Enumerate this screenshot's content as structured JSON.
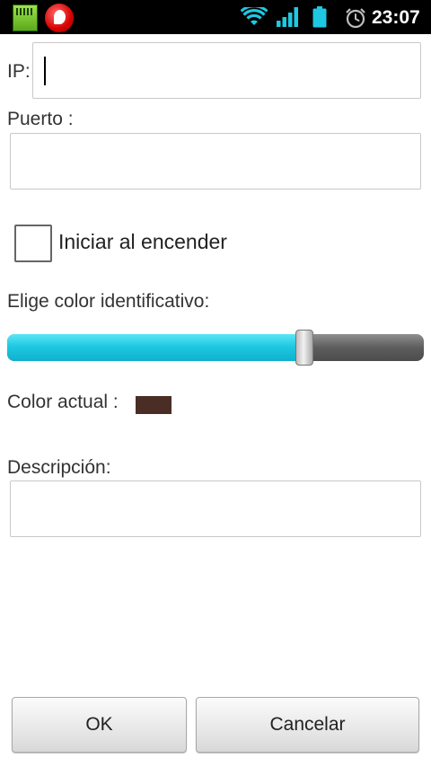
{
  "status_bar": {
    "time": "23:07",
    "icons": [
      "sd-card-icon",
      "vodafone-icon",
      "wifi-icon",
      "signal-icon",
      "battery-icon",
      "alarm-icon"
    ]
  },
  "form": {
    "ip_label": "IP:",
    "ip_value": "",
    "port_label": "Puerto :",
    "port_value": "",
    "startup_label": "Iniciar al encender",
    "startup_checked": false,
    "color_id_label": "Elige color identificativo:",
    "slider_value": 0.713,
    "current_color_label": "Color actual :",
    "current_color": "#4a2e26",
    "description_label": "Descripción:",
    "description_value": ""
  },
  "buttons": {
    "ok_label": "OK",
    "cancel_label": "Cancelar"
  },
  "colors": {
    "slider_fill": "#1fc8e2",
    "slider_track": "#5d5d5d",
    "status_bar_bg": "#000000",
    "text": "#333333"
  }
}
